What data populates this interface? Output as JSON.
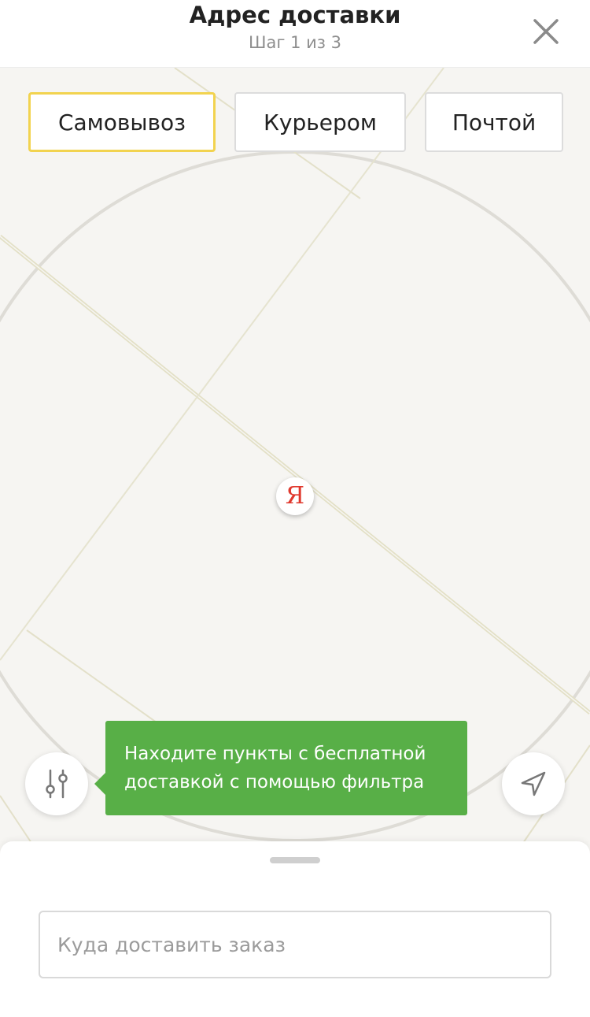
{
  "header": {
    "title": "Адрес доставки",
    "subtitle": "Шаг 1 из 3"
  },
  "tabs": [
    {
      "label": "Самовывоз",
      "active": true
    },
    {
      "label": "Курьером",
      "active": false
    },
    {
      "label": "Почтой",
      "active": false
    }
  ],
  "map": {
    "pin_logo": "Я"
  },
  "tooltip": {
    "line1": "Находите пункты с бесплатной",
    "line2": "доставкой с помощью фильтра"
  },
  "search": {
    "placeholder": "Куда доставить заказ",
    "value": ""
  },
  "colors": {
    "accent_yellow": "#f2d34f",
    "tooltip_green": "#58af47",
    "pin_red": "#e0392e"
  },
  "icons": {
    "close": "close-icon",
    "filter": "filter-sliders-icon",
    "locate": "navigation-arrow-icon"
  }
}
